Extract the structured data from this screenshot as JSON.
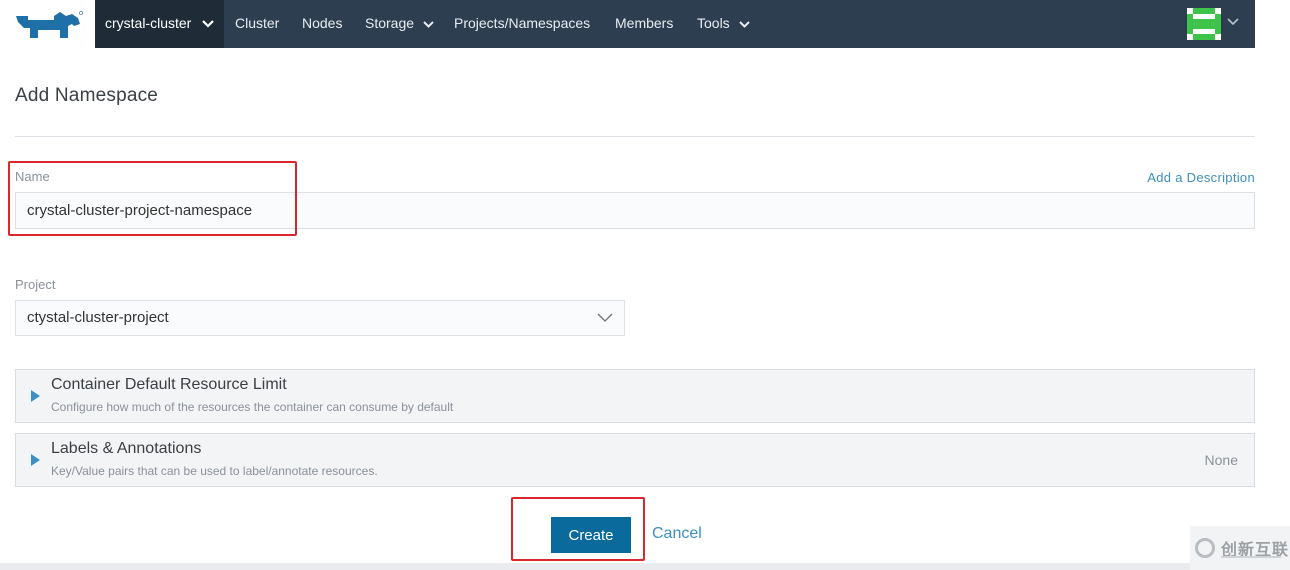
{
  "nav": {
    "cluster": "crystal-cluster",
    "items": [
      "Cluster",
      "Nodes",
      "Storage",
      "Projects/Namespaces",
      "Members",
      "Tools"
    ]
  },
  "page": {
    "title": "Add Namespace"
  },
  "form": {
    "name_label": "Name",
    "add_description": "Add a Description",
    "name_value": "crystal-cluster-project-namespace",
    "project_label": "Project",
    "project_value": "ctystal-cluster-project"
  },
  "sections": {
    "resource_limit": {
      "title": "Container Default Resource Limit",
      "subtitle": "Configure how much of the resources the container can consume by default"
    },
    "labels": {
      "title": "Labels & Annotations",
      "subtitle": "Key/Value pairs that can be used to label/annotate resources.",
      "status": "None"
    }
  },
  "actions": {
    "create": "Create",
    "cancel": "Cancel"
  },
  "watermark": {
    "text": "创新互联"
  },
  "colors": {
    "nav_bg": "#2d3e50",
    "primary": "#0a6a9c",
    "link": "#3d8fbf",
    "highlight": "#d9272e",
    "avatar": "#3ec44a"
  },
  "icons": [
    "rancher-logo-icon",
    "chevron-down-icon",
    "caret-right-icon",
    "avatar-icon"
  ]
}
